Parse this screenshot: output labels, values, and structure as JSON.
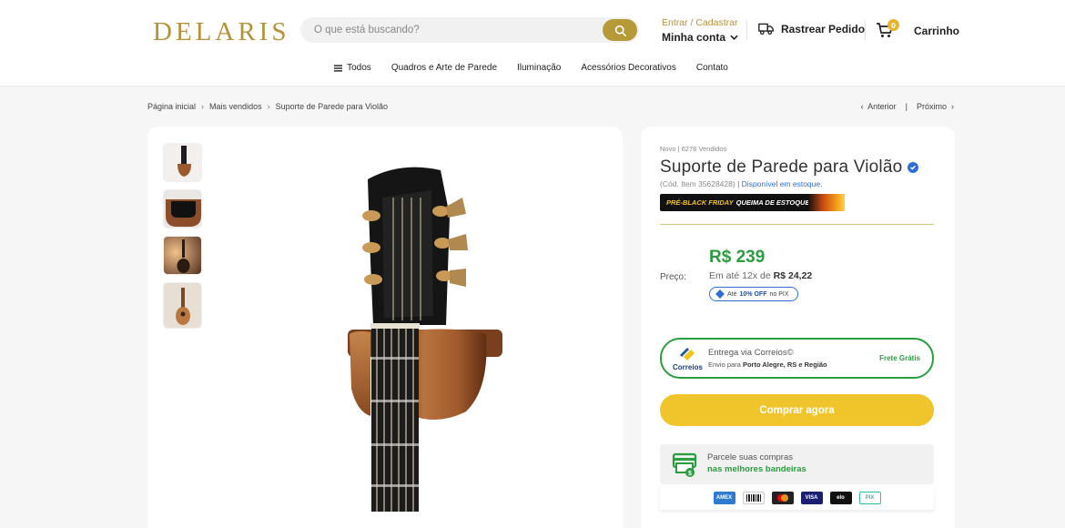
{
  "header": {
    "logo": "DELARIS",
    "search_placeholder": "O que está buscando?",
    "account_top": "Entrar / Cadastrar",
    "account_bottom": "Minha conta",
    "track": "Rastrear Pedido",
    "cart_count": "0",
    "cart_label": "Carrinho"
  },
  "nav": {
    "items": [
      "Todos",
      "Quadros e Arte de Parede",
      "Iluminação",
      "Acessórios Decorativos",
      "Contato"
    ]
  },
  "breadcrumb": {
    "items": [
      "Página inicial",
      "Mais vendidos",
      "Suporte de Parede para Violão"
    ],
    "prev": "Anterior",
    "next": "Próximo"
  },
  "product": {
    "meta": "Novo | 6278 Vendidos",
    "title": "Suporte de Parede para Violão",
    "code": "(Cód. Item 35628428)",
    "stock": "| Disponível em estoque.",
    "banner_pre": "PRÉ-BLACK FRIDAY",
    "banner_main": "QUEIMA DE ESTOQUE",
    "price_label": "Preço:",
    "price": "R$ 239",
    "installment_prefix": "Em até 12x de",
    "installment_value": "R$ 24,22",
    "pix_prefix": "Até",
    "pix_discount": "10% OFF",
    "pix_suffix": "no PIX"
  },
  "shipping": {
    "carrier": "Correios",
    "line1": "Entrega via Correios©",
    "line2_prefix": "Envio para",
    "line2_place": "Porto Alegre, RS e Região",
    "free": "Frete Grátis"
  },
  "buy_label": "Comprar agora",
  "parcele": {
    "line1": "Parcele suas compras",
    "line2": "nas melhores bandeiras"
  },
  "payment_cards": [
    "AMEX",
    "Boleto",
    "Mastercard",
    "VISA",
    "elo",
    "PIX"
  ],
  "colors": {
    "brand_gold": "#b5913a",
    "price_green": "#2a9d3f",
    "buy_yellow": "#f0c52b",
    "link_blue": "#2d6fd3"
  }
}
